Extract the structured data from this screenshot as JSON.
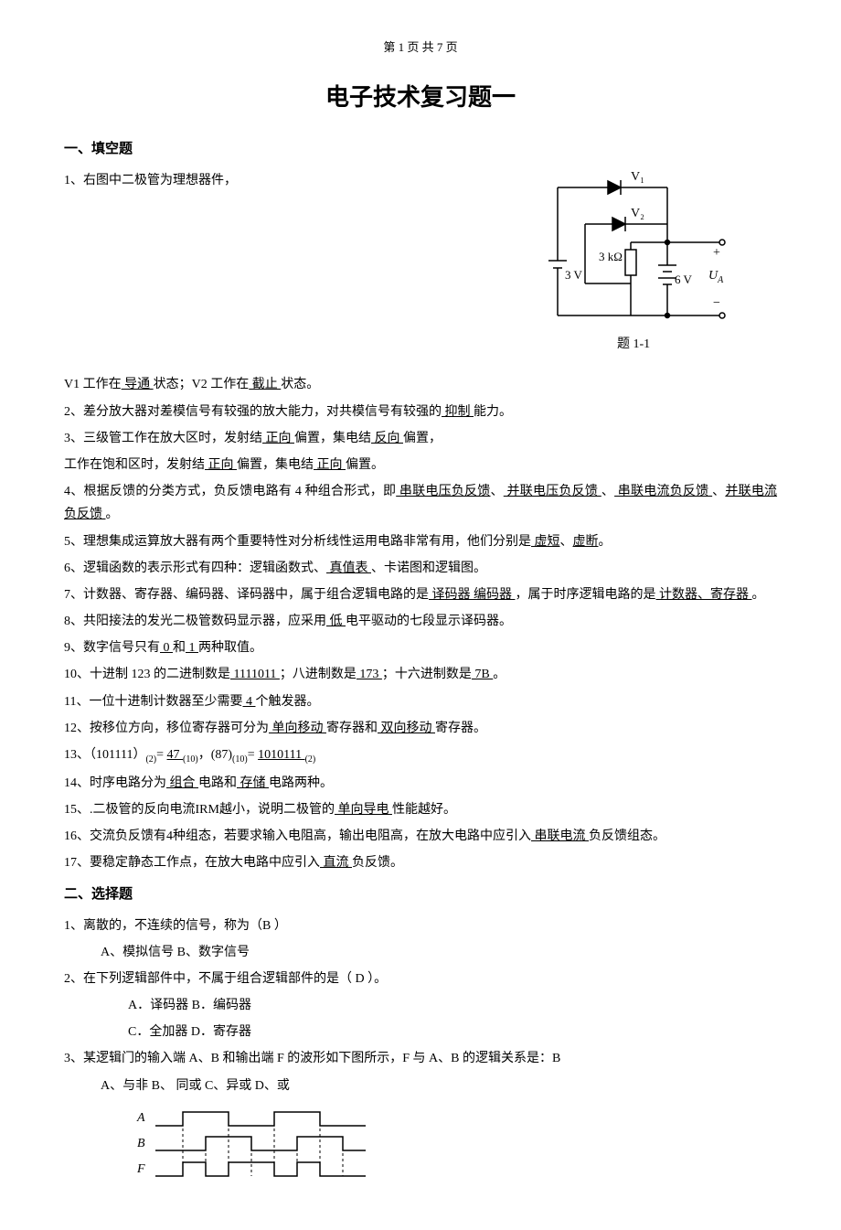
{
  "header": {
    "text": "第 1 页 共 7 页"
  },
  "title": "电子技术复习题一",
  "section1": {
    "heading": "一、填空题"
  },
  "circuit": {
    "v1": "V₁",
    "v2": "V₂",
    "r": "3 kΩ",
    "src1": "3 V",
    "src2": "6 V",
    "ua": "U",
    "ua_sub": "A",
    "plus": "+",
    "minus": "−",
    "caption": "题 1-1"
  },
  "q1": {
    "line1": "1、右图中二极管为理想器件，",
    "line2_pre": "V1 工作在",
    "line2_a1": "  导通  ",
    "line2_mid": " 状态；V2 工作在",
    "line2_a2": "  截止  ",
    "line2_post": "状态。"
  },
  "q2": {
    "pre": "2、差分放大器对差模信号有较强的放大能力，对共模信号有较强的",
    "a1": "  抑制  ",
    "post": "能力。"
  },
  "q3": {
    "pre": "3、三级管工作在放大区时，发射结",
    "a1": "  正向  ",
    "mid1": "偏置，集电结",
    "a2": "  反向  ",
    "post1": "偏置，",
    "line2_pre": "工作在饱和区时，发射结",
    "line2_a1": "  正向 ",
    "line2_mid": "偏置，集电结",
    "line2_a2": " 正向  ",
    "line2_post": "偏置。"
  },
  "q4": {
    "pre": "4、根据反馈的分类方式，负反馈电路有 4 种组合形式，即",
    "a1": " 串联电压负反馈",
    "mid1": "、",
    "a2": "  并联电压负反馈   ",
    "mid2": "、",
    "a3": "  串联电流负反馈  ",
    "mid3": "、",
    "a4": "并联电流负反馈  ",
    "post": "。"
  },
  "q5": {
    "pre": "5、理想集成运算放大器有两个重要特性对分析线性运用电路非常有用，他们分别是",
    "a1": " 虚短",
    "mid": "、",
    "a2": "虚断",
    "post": "。"
  },
  "q6": {
    "pre": "6、逻辑函数的表示形式有四种：逻辑函数式、",
    "a1": "         真值表      ",
    "post": "、卡诺图和逻辑图。"
  },
  "q7": {
    "pre": "7、计数器、寄存器、编码器、译码器中，属于组合逻辑电路的是",
    "a1": "   译码器    编码器    ",
    "mid": "，属于时序逻辑电路的是",
    "a2": "        计数器、寄存器         ",
    "post": "。"
  },
  "q8": {
    "pre": "8、共阳接法的发光二极管数码显示器，应采用",
    "a1": "     低         ",
    "post": "电平驱动的七段显示译码器。"
  },
  "q9": {
    "pre": "9、数字信号只有",
    "a1": "  0           ",
    "mid": " 和",
    "a2": "   1          ",
    "post": " 两种取值。"
  },
  "q10": {
    "pre": "10、十进制 123 的二进制数是",
    "a1": "   1111011          ",
    "mid1": " ；八进制数是",
    "a2": "  173           ",
    "mid2": " ；十六进制数是",
    "a3": "   7B           ",
    "post": " 。"
  },
  "q11": {
    "pre": "11、一位十进制计数器至少需要",
    "a1": "     4       ",
    "post": "个触发器。"
  },
  "q12": {
    "pre": "12、按移位方向，移位寄存器可分为",
    "a1": "     单向移动           ",
    "mid": "寄存器和",
    "a2": "  双向移动             ",
    "post": "寄存器。"
  },
  "q13": {
    "pre": "13、（101111）",
    "sub1": "(2)",
    "mid1": "= ",
    "a1": "    47               ",
    "sub2": "(10)",
    "mid2": "，(87)",
    "sub3": "(10)",
    "mid3": "= ",
    "a2": "  1010111             ",
    "sub4": "(2)"
  },
  "q14": {
    "pre": "14、时序电路分为",
    "a1": "    组合             ",
    "mid": "电路和",
    "a2": "   存储             ",
    "post": "电路两种。"
  },
  "q15": {
    "pre": "15、.二极管的反向电流IRM越小，说明二极管的",
    "a1": "     单向导电       ",
    "post": "性能越好。"
  },
  "q16": {
    "pre": "16、交流负反馈有4种组态，若要求输入电阻高，输出电阻高，在放大电路中应引入",
    "a1": "  串联电流         ",
    "post": "负反馈组态。"
  },
  "q17": {
    "pre": "17、要稳定静态工作点，在放大电路中应引入",
    "a1": "        直流      ",
    "post": "负反馈。"
  },
  "section2": {
    "heading": "二、选择题"
  },
  "mc1": {
    "q": "1、离散的，不连续的信号，称为（B    ）",
    "opts": "A、模拟信号          B、数字信号"
  },
  "mc2": {
    "q": "2、在下列逻辑部件中，不属于组合逻辑部件的是（   D   ）。",
    "opts1": "A．译码器        B．编码器",
    "opts2": "C．全加器        D．寄存器"
  },
  "mc3": {
    "q": "3、某逻辑门的输入端 A、B 和输出端 F 的波形如下图所示，F 与 A、B 的逻辑关系是：B",
    "opts": "A、与非      B、 同或     C、异或     D、或"
  },
  "wave": {
    "A": "A",
    "B": "B",
    "F": "F"
  }
}
